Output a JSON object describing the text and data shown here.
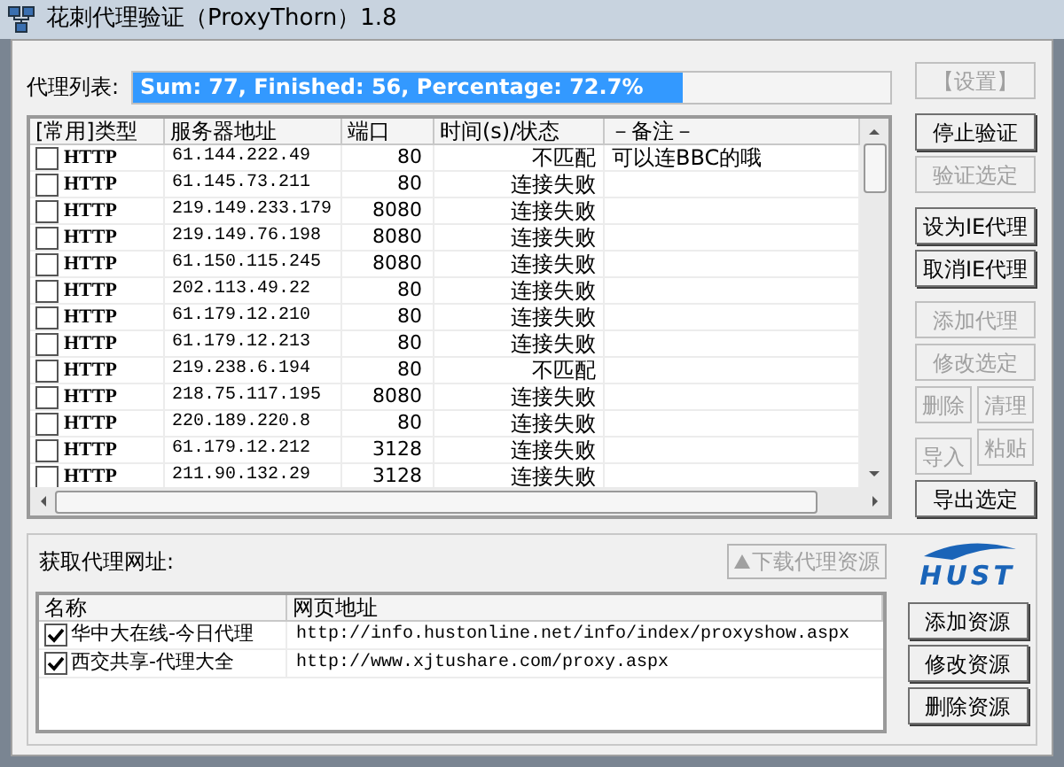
{
  "window": {
    "title": "花刺代理验证（ProxyThorn）1.8"
  },
  "progress": {
    "label": "代理列表:",
    "text": "Sum: 77, Finished: 56, Percentage: 72.7%",
    "level": 0.727
  },
  "proxy_table": {
    "columns": [
      "[常用]类型",
      "服务器地址",
      "端口",
      "时间(s)/状态",
      "－备注－"
    ],
    "rows": [
      {
        "checked": false,
        "type": "HTTP",
        "address": "61.144.222.49",
        "port": "80",
        "status": "不匹配",
        "note": "可以连BBC的哦"
      },
      {
        "checked": false,
        "type": "HTTP",
        "address": "61.145.73.211",
        "port": "80",
        "status": "连接失败"
      },
      {
        "checked": false,
        "type": "HTTP",
        "address": "219.149.233.179",
        "port": "8080",
        "status": "连接失败"
      },
      {
        "checked": false,
        "type": "HTTP",
        "address": "219.149.76.198",
        "port": "8080",
        "status": "连接失败"
      },
      {
        "checked": false,
        "type": "HTTP",
        "address": "61.150.115.245",
        "port": "8080",
        "status": "连接失败"
      },
      {
        "checked": false,
        "type": "HTTP",
        "address": "202.113.49.22",
        "port": "80",
        "status": "连接失败"
      },
      {
        "checked": false,
        "type": "HTTP",
        "address": "61.179.12.210",
        "port": "80",
        "status": "连接失败"
      },
      {
        "checked": false,
        "type": "HTTP",
        "address": "61.179.12.213",
        "port": "80",
        "status": "连接失败"
      },
      {
        "checked": false,
        "type": "HTTP",
        "address": "219.238.6.194",
        "port": "80",
        "status": "不匹配"
      },
      {
        "checked": false,
        "type": "HTTP",
        "address": "218.75.117.195",
        "port": "8080",
        "status": "连接失败"
      },
      {
        "checked": false,
        "type": "HTTP",
        "address": "220.189.220.8",
        "port": "80",
        "status": "连接失败"
      },
      {
        "checked": false,
        "type": "HTTP",
        "address": "61.179.12.212",
        "port": "3128",
        "status": "连接失败"
      },
      {
        "checked": false,
        "type": "HTTP",
        "address": "211.90.132.29",
        "port": "3128",
        "status": "连接失败"
      }
    ]
  },
  "source_section": {
    "label": "获取代理网址:",
    "download_button": {
      "label": "下载代理资源",
      "disabled": true
    }
  },
  "source_table": {
    "columns": [
      "名称",
      "网页地址"
    ],
    "rows": [
      {
        "checked": true,
        "name": "华中大在线-今日代理",
        "url": "http://info.hustonline.net/info/index/proxyshow.aspx"
      },
      {
        "checked": true,
        "name": "西交共享-代理大全",
        "url": "http://www.xjtushare.com/proxy.aspx"
      }
    ]
  },
  "side_buttons": [
    {
      "label": "【设置】",
      "disabled": true,
      "kind": "wide"
    },
    {
      "label": "停止验证",
      "disabled": false,
      "kind": "wide"
    },
    {
      "label": "验证选定",
      "disabled": true,
      "kind": "wide"
    },
    {
      "label": "设为IE代理",
      "disabled": false,
      "kind": "wide"
    },
    {
      "label": "取消IE代理",
      "disabled": false,
      "kind": "wide"
    },
    {
      "label": "添加代理",
      "disabled": true,
      "kind": "wide"
    },
    {
      "label": "修改选定",
      "disabled": true,
      "kind": "wide"
    },
    {
      "label": "删除",
      "disabled": true,
      "kind": "narrow"
    },
    {
      "label": "清理",
      "disabled": true,
      "kind": "narrow"
    },
    {
      "label": "导入",
      "disabled": true,
      "kind": "narrow"
    },
    {
      "label": "粘贴",
      "disabled": true,
      "kind": "narrow"
    },
    {
      "label": "导出选定",
      "disabled": false,
      "kind": "wide"
    }
  ],
  "logo": {
    "text": "HUST"
  },
  "source_buttons": [
    {
      "label": "添加资源"
    },
    {
      "label": "修改资源"
    },
    {
      "label": "删除资源"
    }
  ]
}
